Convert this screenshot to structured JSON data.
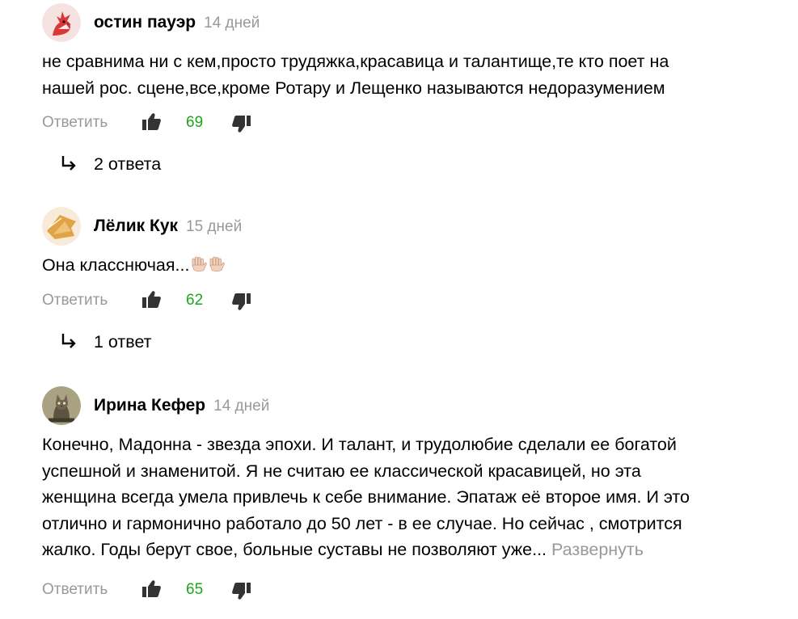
{
  "comments": [
    {
      "author": "остин пауэр",
      "date": "14 дней",
      "lines": [
        "не сравнима ни с кем,просто трудяжка,красавица и талантище,те кто поет на",
        "нашей рос. сцене,все,кроме Ротару и Лещенко называются недоразумением"
      ],
      "reply_label": "Ответить",
      "likes": "69",
      "replies_label": "2 ответа",
      "avatar": "red-cardinal-bird-avatar"
    },
    {
      "author": "Лёлик Кук",
      "date": "15 дней",
      "lines": [
        "Она класснючая..."
      ],
      "emoji": "raised-hands-emoji",
      "reply_label": "Ответить",
      "likes": "62",
      "replies_label": "1 ответ",
      "avatar": "orange-flag-avatar"
    },
    {
      "author": "Ирина Кефер",
      "date": "14 дней",
      "lines": [
        "Конечно, Мадонна - звезда эпохи. И талант, и трудолюбие сделали ее богатой",
        "успешной и знаменитой. Я не считаю ее классической красавицей, но эта",
        "женщина всегда умела привлечь к себе внимание. Эпатаж её второе имя. И это",
        "отлично и гармонично работало до 50 лет - в ее случае. Но сейчас , смотрится",
        "жалко. Годы берут свое, больные суставы не позволяют уже..."
      ],
      "expand_label": "Развернуть",
      "reply_label": "Ответить",
      "likes": "65",
      "avatar": "cat-photo-avatar"
    }
  ],
  "colors": {
    "text": "#000000",
    "muted": "#999999",
    "likes": "#1aa81a",
    "icon": "#333333"
  }
}
